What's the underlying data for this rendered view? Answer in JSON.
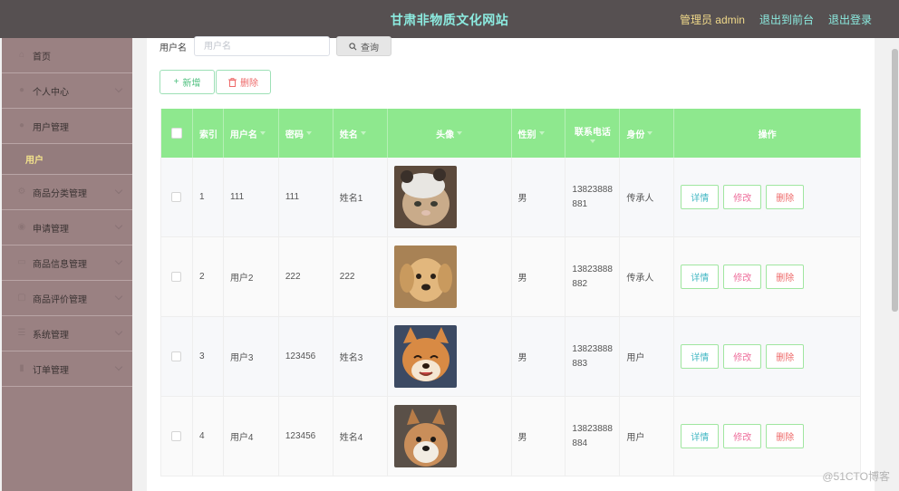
{
  "header": {
    "site_title": "甘肃非物质文化网站",
    "role_label": "管理员 admin",
    "front_link": "退出到前台",
    "logout_link": "退出登录"
  },
  "sidebar": {
    "items": [
      {
        "label": "首页",
        "icon": "home-icon"
      },
      {
        "label": "个人中心",
        "icon": "user-icon"
      },
      {
        "label": "用户管理",
        "icon": "user-icon"
      },
      {
        "label": "用户",
        "icon": ""
      },
      {
        "label": "商品分类管理",
        "icon": "settings-icon"
      },
      {
        "label": "申请管理",
        "icon": "location-icon"
      },
      {
        "label": "商品信息管理",
        "icon": "folder-icon"
      },
      {
        "label": "商品评价管理",
        "icon": "document-icon"
      },
      {
        "label": "系统管理",
        "icon": "menu-icon"
      },
      {
        "label": "订单管理",
        "icon": "chart-icon"
      }
    ]
  },
  "search": {
    "label": "用户名",
    "placeholder": "用户名",
    "button_label": "查询"
  },
  "actions": {
    "add_label": "新增",
    "delete_label": "删除"
  },
  "table": {
    "columns": [
      "索引",
      "用户名",
      "密码",
      "姓名",
      "头像",
      "性别",
      "联系电话",
      "身份",
      "操作"
    ],
    "rows": [
      {
        "index": "1",
        "username": "111",
        "password": "111",
        "name": "姓名1",
        "gender": "男",
        "phone_a": "13823888",
        "phone_b": "881",
        "role": "传承人",
        "avatar": "cat-avatar"
      },
      {
        "index": "2",
        "username": "用户2",
        "password": "222",
        "name": "222",
        "gender": "男",
        "phone_a": "13823888",
        "phone_b": "882",
        "role": "传承人",
        "avatar": "puppy-avatar"
      },
      {
        "index": "3",
        "username": "用户3",
        "password": "123456",
        "name": "姓名3",
        "gender": "男",
        "phone_a": "13823888",
        "phone_b": "883",
        "role": "用户",
        "avatar": "shiba-avatar"
      },
      {
        "index": "4",
        "username": "用户4",
        "password": "123456",
        "name": "姓名4",
        "gender": "男",
        "phone_a": "13823888",
        "phone_b": "884",
        "role": "用户",
        "avatar": "dog-avatar"
      }
    ],
    "ops": {
      "view": "详情",
      "edit": "修改",
      "delete": "删除"
    }
  },
  "watermark": "@51CTO博客",
  "colors": {
    "header_bg": "#565051",
    "title": "#8cebe0",
    "sidebar_bg": "#9a8182",
    "table_header": "#8ee88e"
  }
}
